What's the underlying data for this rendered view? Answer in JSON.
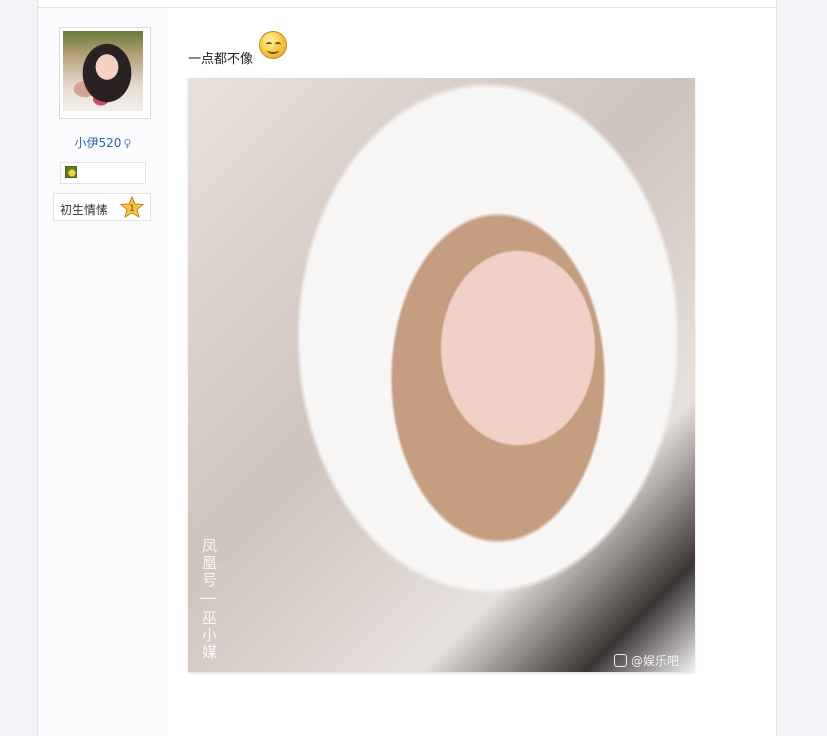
{
  "author": {
    "username": "小伊520",
    "gender_symbol": "♀",
    "level_title": "初生情愫",
    "level_number": "1"
  },
  "post": {
    "text": "一点都不像",
    "emoji": "smile-emoji",
    "image": {
      "watermark_left": "凤凰号 | 巫小媒",
      "watermark_right": "@娱乐吧"
    }
  },
  "colors": {
    "username": "#2d64b3",
    "page_bg": "#f2f3f7",
    "author_col_bg": "#fbfbfd"
  }
}
